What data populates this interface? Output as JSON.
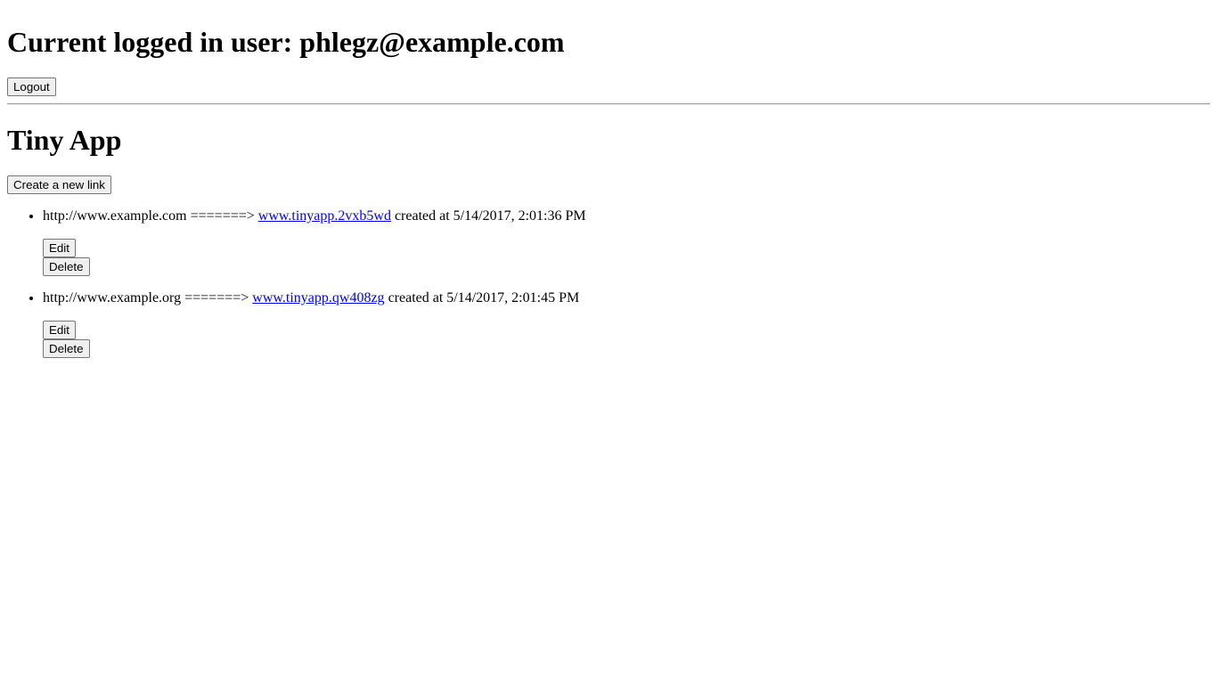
{
  "header": {
    "user_heading": "Current logged in user: phlegz@example.com",
    "logout_label": "Logout"
  },
  "main": {
    "title": "Tiny App",
    "create_label": "Create a new link",
    "links": [
      {
        "long_url": "http://www.example.com",
        "arrow": "=======>",
        "short_url": "www.tinyapp.2vxb5wd",
        "created_text": "created at 5/14/2017, 2:01:36 PM",
        "edit_label": "Edit",
        "delete_label": "Delete"
      },
      {
        "long_url": "http://www.example.org",
        "arrow": "=======>",
        "short_url": "www.tinyapp.qw408zg",
        "created_text": "created at 5/14/2017, 2:01:45 PM",
        "edit_label": "Edit",
        "delete_label": "Delete"
      }
    ]
  },
  "colors": {
    "link": "#0000ee",
    "button_bg": "#efefef",
    "button_border": "#767676"
  }
}
